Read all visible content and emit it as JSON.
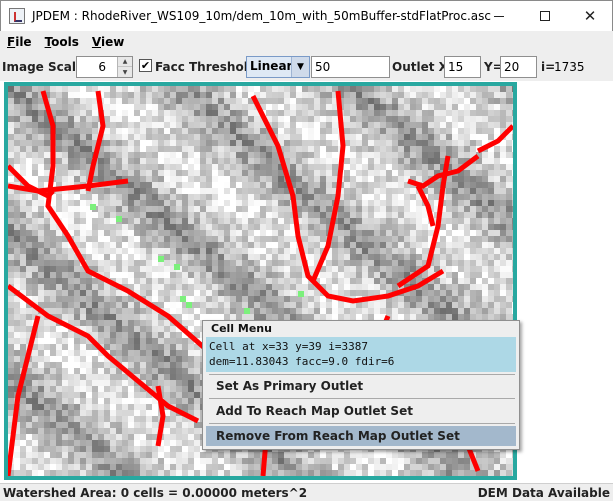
{
  "window": {
    "title": "JPDEM : RhodeRiver_WS109_10m/dem_10m_with_50mBuffer-stdFlatProc.asc",
    "icon": "java-app-icon"
  },
  "menubar": {
    "items": [
      {
        "label": "File"
      },
      {
        "label": "Tools"
      },
      {
        "label": "View"
      }
    ]
  },
  "toolbar": {
    "image_scale_label": "Image Scale",
    "image_scale_value": "6",
    "facc_threshold_label": "Facc Threshold",
    "facc_checked": true,
    "scale_mode": "Linear",
    "threshold_value": "50",
    "outlet_x_label": "Outlet X=",
    "outlet_x_value": "15",
    "outlet_y_label": "Y=",
    "outlet_y_value": "20",
    "index_label": "i=",
    "index_value": "1735"
  },
  "context_menu": {
    "title": "Cell Menu",
    "info_line1": "Cell at x=33 y=39 i=3387",
    "info_line2": "dem=11.83043 facc=9.0 fdir=6",
    "items": [
      {
        "label": "Set As Primary Outlet",
        "highlighted": false
      },
      {
        "label": "Add To Reach Map Outlet Set",
        "highlighted": false
      },
      {
        "label": "Remove From Reach Map Outlet Set",
        "highlighted": true
      }
    ]
  },
  "statusbar": {
    "left": "Watershed Area: 0 cells = 0.00000 meters^2",
    "right": "DEM Data Available"
  },
  "colors": {
    "frame": "#28a8a0",
    "stream": "#ff0000",
    "outlet_marker": "#7cf07c",
    "menu_info_bg": "#add8e6",
    "menu_highlight": "#a3b8cc"
  }
}
